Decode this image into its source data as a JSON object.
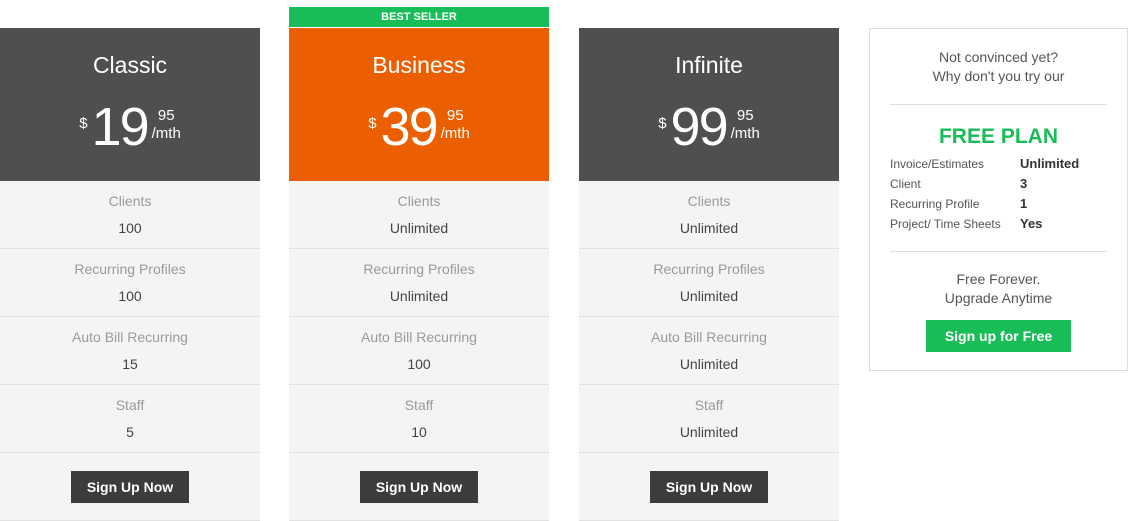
{
  "colors": {
    "dark": "#4f4f4f",
    "orange": "#ec5f00",
    "green": "#18bd57"
  },
  "ribbon": "BEST SELLER",
  "plans": [
    {
      "name": "Classic",
      "currency": "$",
      "amount": "19",
      "cents": "95",
      "period": "/mth",
      "features": [
        {
          "label": "Clients",
          "value": "100"
        },
        {
          "label": "Recurring Profiles",
          "value": "100"
        },
        {
          "label": "Auto Bill Recurring",
          "value": "15"
        },
        {
          "label": "Staff",
          "value": "5"
        }
      ],
      "button": "Sign Up Now"
    },
    {
      "name": "Business",
      "currency": "$",
      "amount": "39",
      "cents": "95",
      "period": "/mth",
      "features": [
        {
          "label": "Clients",
          "value": "Unlimited"
        },
        {
          "label": "Recurring Profiles",
          "value": "Unlimited"
        },
        {
          "label": "Auto Bill Recurring",
          "value": "100"
        },
        {
          "label": "Staff",
          "value": "10"
        }
      ],
      "button": "Sign Up Now"
    },
    {
      "name": "Infinite",
      "currency": "$",
      "amount": "99",
      "cents": "95",
      "period": "/mth",
      "features": [
        {
          "label": "Clients",
          "value": "Unlimited"
        },
        {
          "label": "Recurring Profiles",
          "value": "Unlimited"
        },
        {
          "label": "Auto Bill Recurring",
          "value": "Unlimited"
        },
        {
          "label": "Staff",
          "value": "Unlimited"
        }
      ],
      "button": "Sign Up Now"
    }
  ],
  "free": {
    "intro1": "Not convinced yet?",
    "intro2": "Why don't you try our",
    "title": "FREE PLAN",
    "features": [
      {
        "label": "Invoice/Estimates",
        "value": "Unlimited"
      },
      {
        "label": "Client",
        "value": "3"
      },
      {
        "label": "Recurring Profile",
        "value": "1"
      },
      {
        "label": "Project/ Time Sheets",
        "value": "Yes"
      }
    ],
    "outro1": "Free Forever.",
    "outro2": "Upgrade Anytime",
    "button": "Sign up for Free"
  }
}
